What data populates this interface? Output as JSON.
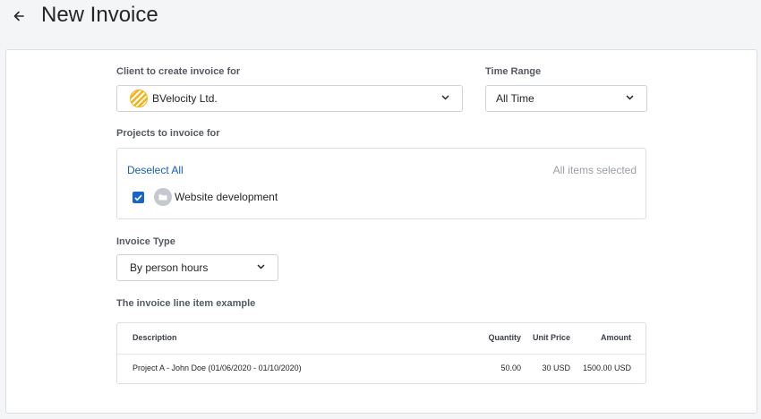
{
  "header": {
    "title": "New Invoice"
  },
  "client": {
    "label": "Client to create invoice for",
    "selected": "BVelocity Ltd."
  },
  "time_range": {
    "label": "Time Range",
    "selected": "All Time"
  },
  "projects": {
    "label": "Projects to invoice for",
    "deselect_label": "Deselect All",
    "status": "All items selected",
    "items": [
      {
        "name": "Website development",
        "checked": true
      }
    ]
  },
  "invoice_type": {
    "label": "Invoice Type",
    "selected": "By person hours"
  },
  "example": {
    "label": "The invoice line item example",
    "columns": {
      "description": "Description",
      "quantity": "Quantity",
      "unit_price": "Unit Price",
      "amount": "Amount"
    },
    "rows": [
      {
        "description": "Project A - John Doe (01/06/2020 - 01/10/2020)",
        "quantity": "50.00",
        "unit_price": "30 USD",
        "amount": "1500.00 USD"
      }
    ]
  },
  "colors": {
    "accent": "#1866c4",
    "link": "#1a5fb4",
    "client_logo": "#f5b21b"
  },
  "icons": {
    "back": "arrow-left-icon",
    "dropdown": "chevron-down-icon",
    "checkbox": "checkmark-icon",
    "project": "folder-icon"
  }
}
